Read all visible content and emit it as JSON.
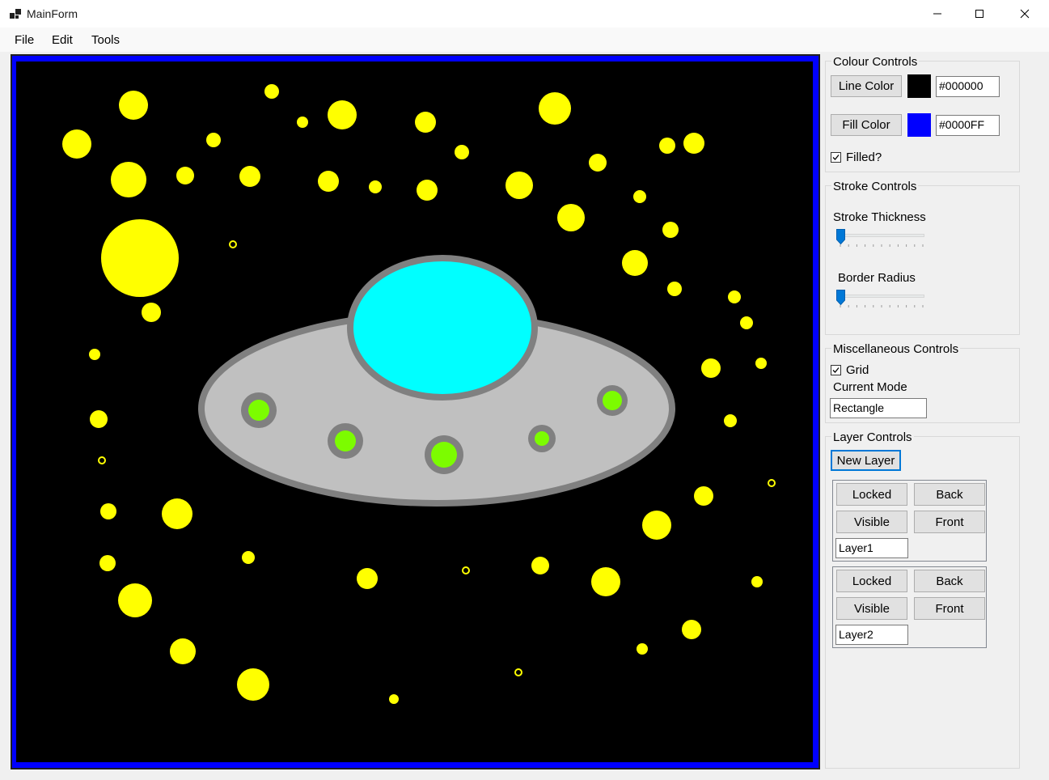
{
  "window": {
    "title": "MainForm"
  },
  "menu": {
    "items": [
      "File",
      "Edit",
      "Tools"
    ]
  },
  "colour_controls": {
    "title": "Colour Controls",
    "line_color_label": "Line Color",
    "line_color_hex": "#000000",
    "fill_color_label": "Fill Color",
    "fill_color_hex": "#0000FF",
    "filled_label": "Filled?",
    "filled_checked": true
  },
  "stroke_controls": {
    "title": "Stroke Controls",
    "thickness_label": "Stroke Thickness",
    "thickness_value": 0,
    "radius_label": "Border Radius",
    "radius_value": 0
  },
  "misc_controls": {
    "title": "Miscellaneous Controls",
    "grid_label": "Grid",
    "grid_checked": true,
    "current_mode_label": "Current Mode",
    "current_mode_value": "Rectangle"
  },
  "layer_controls": {
    "title": "Layer Controls",
    "new_layer_label": "New Layer",
    "layers": [
      {
        "locked_label": "Locked",
        "back_label": "Back",
        "visible_label": "Visible",
        "front_label": "Front",
        "name": "Layer1"
      },
      {
        "locked_label": "Locked",
        "back_label": "Back",
        "visible_label": "Visible",
        "front_label": "Front",
        "name": "Layer2"
      }
    ]
  },
  "colors": {
    "canvas_border": "#0000ff",
    "canvas_background": "#000000",
    "stars": "#ffff00",
    "ufo_body": "#c0c0c0",
    "ufo_outline": "#808080",
    "ufo_dome": "#00ffff",
    "ufo_lights": "#7cfc00",
    "accent": "#0078d7"
  },
  "icons": [
    "app-icon",
    "minimize-icon",
    "maximize-icon",
    "close-icon",
    "checkbox-check-icon"
  ]
}
